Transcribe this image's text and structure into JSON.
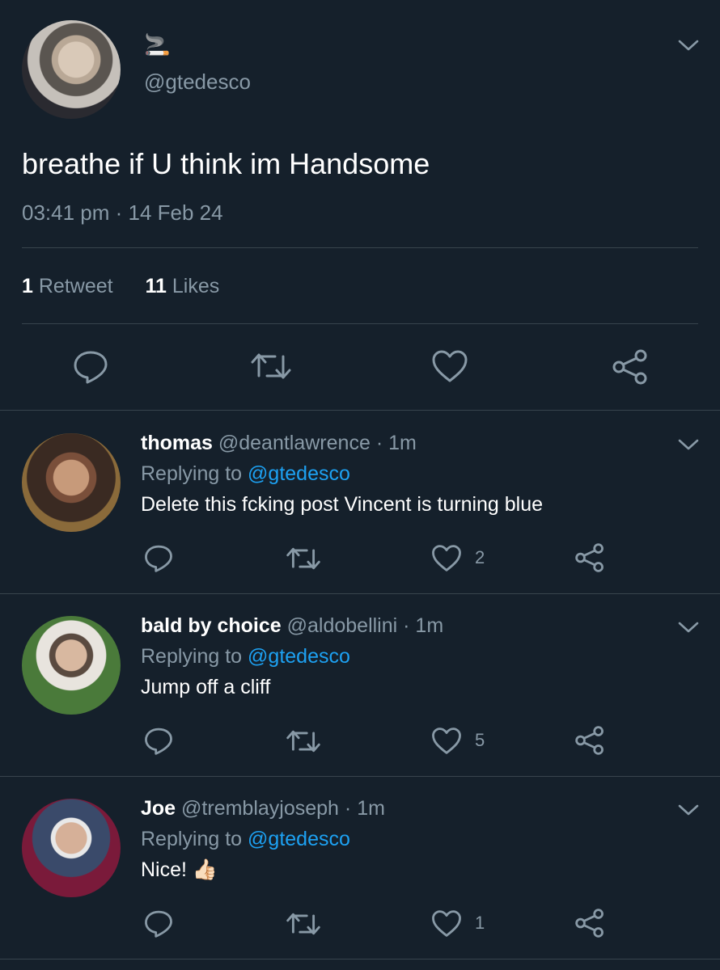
{
  "main_tweet": {
    "display_name": "🚬",
    "handle": "@gtedesco",
    "text": "breathe if U think im Handsome",
    "timestamp": "03:41 pm · 14 Feb 24",
    "retweets_count": "1",
    "retweets_label": "Retweet",
    "likes_count": "11",
    "likes_label": "Likes"
  },
  "replies": [
    {
      "name": "thomas",
      "handle": "@deantlawrence",
      "time": "· 1m",
      "replying_prefix": "Replying to",
      "replying_handle": "@gtedesco",
      "text": "Delete this fcking post Vincent is turning blue",
      "likes": "2"
    },
    {
      "name": "bald by choice",
      "handle": "@aldobellini",
      "time": "· 1m",
      "replying_prefix": "Replying to",
      "replying_handle": "@gtedesco",
      "text": "Jump off a cliff",
      "likes": "5"
    },
    {
      "name": "Joe",
      "handle": "@tremblayjoseph",
      "time": "· 1m",
      "replying_prefix": "Replying to",
      "replying_handle": "@gtedesco",
      "text": "Nice! 👍🏻",
      "likes": "1"
    }
  ],
  "icons": [
    "chevron-down-icon",
    "reply-icon",
    "retweet-icon",
    "like-icon",
    "share-icon"
  ],
  "colors": {
    "background": "#15202b",
    "muted": "#8899a6",
    "link": "#1da1f2",
    "divider": "#38444d"
  }
}
